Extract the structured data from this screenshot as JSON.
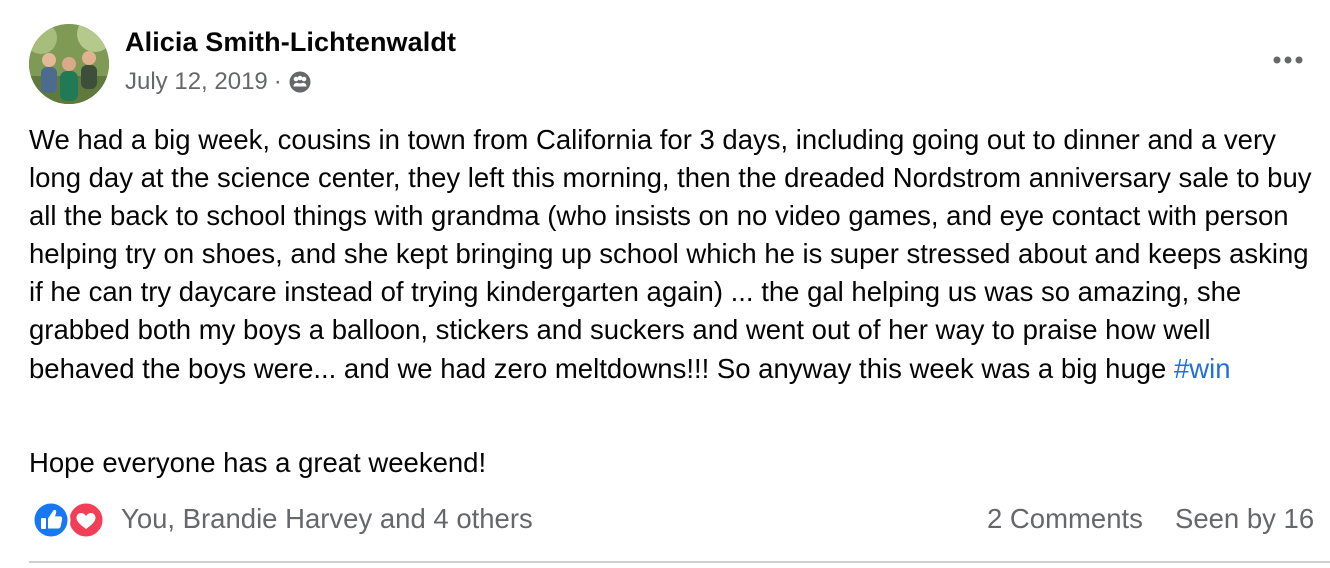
{
  "post": {
    "author": "Alicia Smith-Lichtenwaldt",
    "date": "July 12, 2019",
    "separator": "·",
    "audience_icon": "group-audience-icon",
    "more_icon": "more-options-icon",
    "body_lines": "We had a big week, cousins in town from California for 3 days, including going out to dinner and a very long day at the science center, they left this morning, then the dreaded Nordstrom anniversary sale to buy all the back to school things with grandma (who insists on no video games, and eye contact with person helping try on shoes, and she kept bringing up school which he is super stressed about and keeps asking if he can try daycare instead of trying kindergarten again) ... the gal helping us was so amazing, she grabbed both my boys a balloon, stickers and suckers and went out of her way to praise how well behaved the boys were... and we had zero meltdowns!!! So anyway this week was a big huge ",
    "hashtag": "#win",
    "closing": "Hope everyone has a great weekend!"
  },
  "reactions": {
    "icons": [
      "like-icon",
      "love-icon"
    ],
    "summary": "You, Brandie Harvey and 4 others",
    "comments": "2 Comments",
    "seen": "Seen by 16"
  },
  "colors": {
    "link": "#216fdb",
    "secondary_text": "#65676b",
    "like": "#1877f2",
    "love": "#f33e58"
  }
}
